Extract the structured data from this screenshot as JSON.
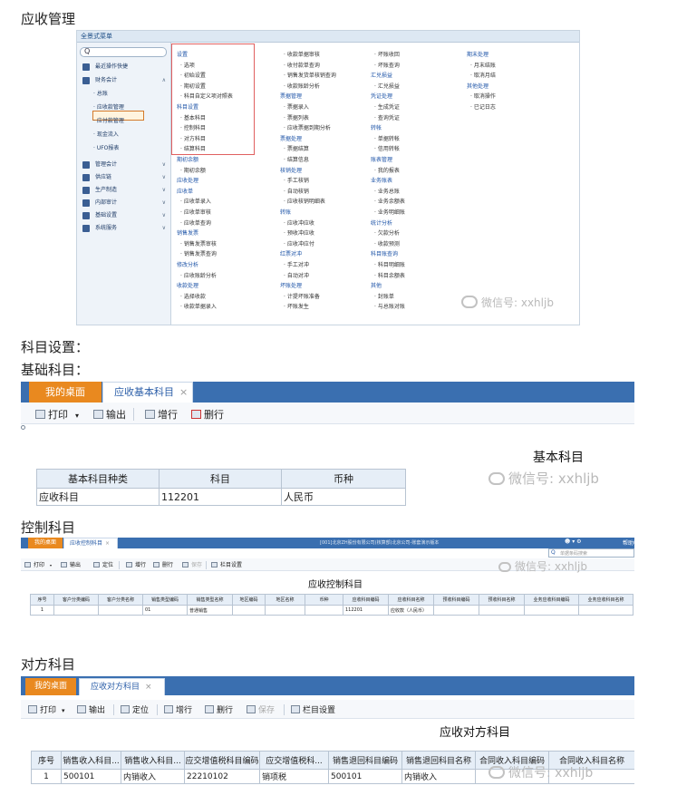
{
  "headings": {
    "receivables": "应收管理",
    "account_settings": "科目设置：",
    "basic_accounts": "基础科目：",
    "control_accounts": "控制科目",
    "offset_accounts": "对方科目"
  },
  "watermark": "微信号: xxhljb",
  "menu_panel": {
    "header": "全景式菜单",
    "search_glyph": "Q",
    "sidebar_top": [
      {
        "label": "最近操作快捷",
        "icon": "clock-icon"
      },
      {
        "label": "财务会计",
        "icon": "finance-icon",
        "arrow": "∧"
      }
    ],
    "sidebar_sub": [
      "· 总账",
      "· 应收款管理",
      "· 应付款管理",
      "· 现金流入",
      "· UFO报表"
    ],
    "sidebar_bottom": [
      {
        "label": "管理会计",
        "icon": "chart-icon"
      },
      {
        "label": "供应链",
        "icon": "supply-icon"
      },
      {
        "label": "生产制造",
        "icon": "factory-icon"
      },
      {
        "label": "内部审计",
        "icon": "audit-icon"
      },
      {
        "label": "基础设置",
        "icon": "settings-icon"
      },
      {
        "label": "系统服务",
        "icon": "service-icon"
      }
    ],
    "col1": [
      {
        "t": "g",
        "s": "设置"
      },
      {
        "t": "t",
        "s": "· 选项"
      },
      {
        "t": "t",
        "s": "· 初始设置"
      },
      {
        "t": "t",
        "s": "· 期初设置"
      },
      {
        "t": "t",
        "s": "· 科目自定义项对照表"
      },
      {
        "t": "g",
        "s": "科目设置"
      },
      {
        "t": "t",
        "s": "· 基本科目"
      },
      {
        "t": "t",
        "s": "· 控制科目"
      },
      {
        "t": "t",
        "s": "· 对方科目"
      },
      {
        "t": "t",
        "s": "· 结算科目"
      },
      {
        "t": "g",
        "s": "期初余额"
      },
      {
        "t": "t",
        "s": "· 期初余额"
      },
      {
        "t": "g",
        "s": "应收处理"
      },
      {
        "t": "g",
        "s": "应收单"
      },
      {
        "t": "t",
        "s": "· 应收单录入"
      },
      {
        "t": "t",
        "s": "· 应收单审核"
      },
      {
        "t": "t",
        "s": "· 应收单查询"
      },
      {
        "t": "g",
        "s": "销售发票"
      },
      {
        "t": "t",
        "s": "· 销售发票审核"
      },
      {
        "t": "t",
        "s": "· 销售发票查询"
      },
      {
        "t": "g",
        "s": "修改分析"
      },
      {
        "t": "t",
        "s": "· 应收账龄分析"
      },
      {
        "t": "g",
        "s": "收款处理"
      },
      {
        "t": "t",
        "s": "· 选择收款"
      },
      {
        "t": "t",
        "s": "· 收款单据录入"
      }
    ],
    "col2": [
      {
        "t": "t",
        "s": "· 收款单据审核"
      },
      {
        "t": "t",
        "s": "· 收付款单查询"
      },
      {
        "t": "t",
        "s": "· 销售发货单核销查询"
      },
      {
        "t": "t",
        "s": "· 收款账龄分析"
      },
      {
        "t": "g",
        "s": "票据管理"
      },
      {
        "t": "t",
        "s": "· 票据录入"
      },
      {
        "t": "t",
        "s": "· 票据列表"
      },
      {
        "t": "t",
        "s": "· 应收票据到期分析"
      },
      {
        "t": "g",
        "s": "票据处理"
      },
      {
        "t": "t",
        "s": "· 票据结算"
      },
      {
        "t": "t",
        "s": "· 结算信息"
      },
      {
        "t": "g",
        "s": "核销处理"
      },
      {
        "t": "t",
        "s": "· 手工核销"
      },
      {
        "t": "t",
        "s": "· 自动核销"
      },
      {
        "t": "t",
        "s": "· 应收核销明细表"
      },
      {
        "t": "g",
        "s": "转账"
      },
      {
        "t": "t",
        "s": "· 应收冲应收"
      },
      {
        "t": "t",
        "s": "· 预收冲应收"
      },
      {
        "t": "t",
        "s": "· 应收冲应付"
      },
      {
        "t": "g",
        "s": "红票对冲"
      },
      {
        "t": "t",
        "s": "· 手工对冲"
      },
      {
        "t": "t",
        "s": "· 自动对冲"
      },
      {
        "t": "g",
        "s": "坏账处理"
      },
      {
        "t": "t",
        "s": "· 计提坏账准备"
      },
      {
        "t": "t",
        "s": "· 坏账发生"
      }
    ],
    "col3": [
      {
        "t": "t",
        "s": "· 坏账收回"
      },
      {
        "t": "t",
        "s": "· 坏账查询"
      },
      {
        "t": "g",
        "s": "汇兑损益"
      },
      {
        "t": "t",
        "s": "· 汇兑损益"
      },
      {
        "t": "g",
        "s": "凭证处理"
      },
      {
        "t": "t",
        "s": "· 生成凭证"
      },
      {
        "t": "t",
        "s": "· 查询凭证"
      },
      {
        "t": "g",
        "s": "转帐"
      },
      {
        "t": "t",
        "s": "· 单据转帐"
      },
      {
        "t": "t",
        "s": "· 信用转帐"
      },
      {
        "t": "g",
        "s": "账表管理"
      },
      {
        "t": "t",
        "s": "· 我的报表"
      },
      {
        "t": "g",
        "s": "业务账表"
      },
      {
        "t": "t",
        "s": "· 业务总账"
      },
      {
        "t": "t",
        "s": "· 业务余额表"
      },
      {
        "t": "t",
        "s": "· 业务明细账"
      },
      {
        "t": "g",
        "s": "统计分析"
      },
      {
        "t": "t",
        "s": "· 欠款分析"
      },
      {
        "t": "t",
        "s": "· 收款预测"
      },
      {
        "t": "g",
        "s": "科目账查询"
      },
      {
        "t": "t",
        "s": "· 科目明细账"
      },
      {
        "t": "t",
        "s": "· 科目余额表"
      },
      {
        "t": "g",
        "s": "其他"
      },
      {
        "t": "t",
        "s": "· 封账单"
      },
      {
        "t": "t",
        "s": "· 与总账对账"
      }
    ],
    "col4": [
      {
        "t": "g",
        "s": "期末处理"
      },
      {
        "t": "t",
        "s": "· 月末结账"
      },
      {
        "t": "t",
        "s": "· 取消月结"
      },
      {
        "t": "g",
        "s": "其他处理"
      },
      {
        "t": "t",
        "s": "· 取消操作"
      },
      {
        "t": "t",
        "s": "· 已记日志"
      }
    ]
  },
  "basic": {
    "tab_home": "我的桌面",
    "tab_active": "应收基本科目",
    "toolbar": {
      "print": "打印",
      "output": "输出",
      "add_row": "增行",
      "del_row": "删行"
    },
    "title": "基本科目",
    "headers": [
      "基本科目种类",
      "科目",
      "币种"
    ],
    "rows": [
      [
        "应收科目",
        "112201",
        "人民币"
      ]
    ]
  },
  "control": {
    "tab_home": "我的桌面",
    "tab_active": "应收控制科目",
    "topbar_info": "[001]北京ZH股份有限公司(核算部)北京公司-账套演示版本",
    "help_menu": "帮助中心",
    "search_placeholder": "单据条码搜索",
    "toolbar": {
      "print": "打印",
      "output": "输出",
      "locate": "定位",
      "add_row": "增行",
      "del_row": "删行",
      "save": "保存",
      "column_settings": "栏目设置"
    },
    "title": "应收控制科目",
    "headers": [
      "序号",
      "客户分类编码",
      "客户分类名称",
      "销售类型编码",
      "销售类型名称",
      "地区编码",
      "地区名称",
      "币种",
      "应收科目编码",
      "应收科目名称",
      "预收科目编码",
      "预收科目名称",
      "业务应收科目编码",
      "业务应收科目名称"
    ],
    "rows": [
      [
        "1",
        "",
        "",
        "01",
        "普通销售",
        "",
        "",
        "",
        "112201",
        "应收款（人民币）",
        "",
        "",
        "",
        ""
      ]
    ]
  },
  "offset": {
    "tab_home": "我的桌面",
    "tab_active": "应收对方科目",
    "toolbar": {
      "print": "打印",
      "output": "输出",
      "locate": "定位",
      "add_row": "增行",
      "del_row": "删行",
      "save": "保存",
      "column_settings": "栏目设置"
    },
    "title": "应收对方科目",
    "headers": [
      "序号",
      "销售收入科目...",
      "销售收入科目...",
      "应交增值税科目编码",
      "应交增值税科...",
      "销售退回科目编码",
      "销售退回科目名称",
      "合同收入科目编码",
      "合同收入科目名称"
    ],
    "rows": [
      [
        "1",
        "500101",
        "内销收入",
        "22210102",
        "销项税",
        "500101",
        "内销收入",
        "",
        ""
      ]
    ]
  }
}
